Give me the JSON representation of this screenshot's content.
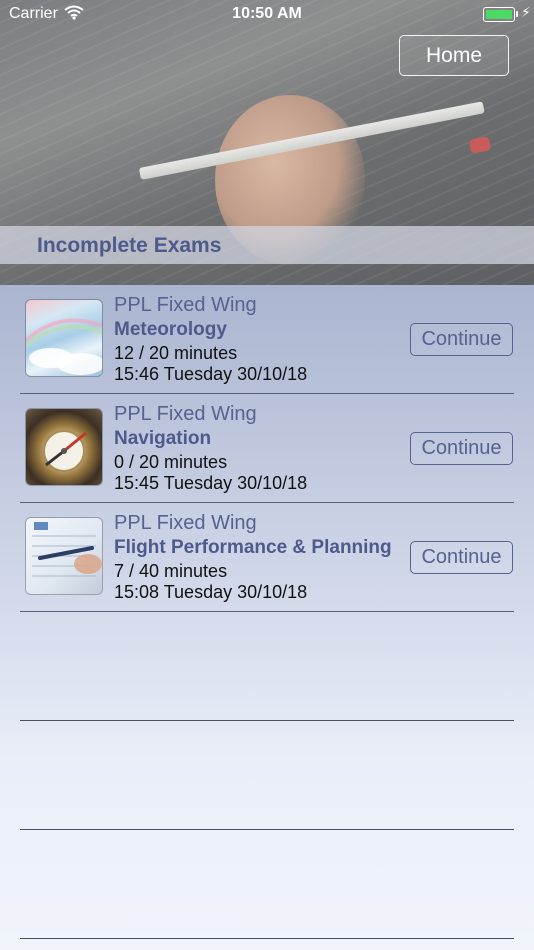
{
  "status_bar": {
    "carrier": "Carrier",
    "time": "10:50 AM"
  },
  "header": {
    "home_label": "Home",
    "section_title": "Incomplete Exams"
  },
  "exams": [
    {
      "type": "PPL Fixed Wing",
      "subject": "Meteorology",
      "progress": "12 / 20 minutes",
      "started": "15:46 Tuesday 30/10/18",
      "action": "Continue",
      "thumbnail": "sky-rainbow"
    },
    {
      "type": "PPL Fixed Wing",
      "subject": "Navigation",
      "progress": "0 / 20 minutes",
      "started": "15:45 Tuesday 30/10/18",
      "action": "Continue",
      "thumbnail": "compass"
    },
    {
      "type": "PPL Fixed Wing",
      "subject": "Flight Performance & Planning",
      "progress": "7 / 40 minutes",
      "started": "15:08 Tuesday 30/10/18",
      "action": "Continue",
      "thumbnail": "chart-pen"
    }
  ],
  "colors": {
    "accent": "#4e5a8b",
    "battery": "#4cd964"
  }
}
